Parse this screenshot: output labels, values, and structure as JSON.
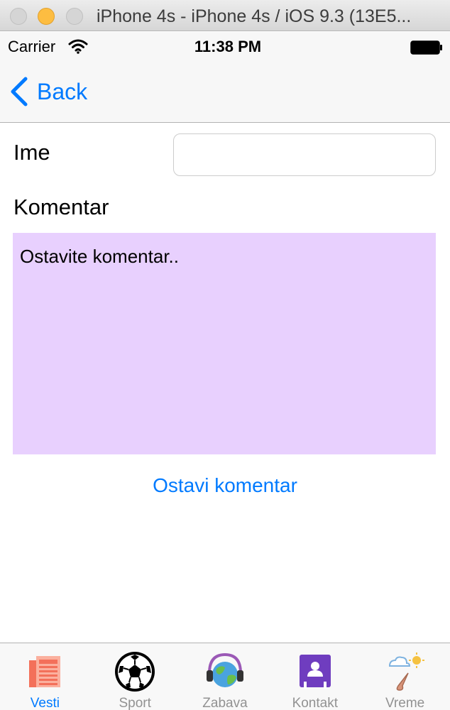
{
  "window": {
    "title": "iPhone 4s - iPhone 4s / iOS 9.3 (13E5..."
  },
  "status_bar": {
    "carrier": "Carrier",
    "time": "11:38 PM",
    "icons": [
      "wifi-icon",
      "battery-icon"
    ]
  },
  "nav": {
    "back_label": "Back",
    "back_icon": "chevron-left-icon",
    "accent_color": "#007aff"
  },
  "form": {
    "name_label": "Ime",
    "name_value": "",
    "comment_label": "Komentar",
    "comment_value": "Ostavite komentar..",
    "comment_bg": "#e8d0fe",
    "submit_label": "Ostavi komentar"
  },
  "tabs": [
    {
      "label": "Vesti",
      "icon": "newspaper-icon",
      "active": true
    },
    {
      "label": "Sport",
      "icon": "soccer-ball-icon",
      "active": false
    },
    {
      "label": "Zabava",
      "icon": "globe-headphones-icon",
      "active": false
    },
    {
      "label": "Kontakt",
      "icon": "contact-book-icon",
      "active": false
    },
    {
      "label": "Vreme",
      "icon": "weather-icon",
      "active": false
    }
  ]
}
